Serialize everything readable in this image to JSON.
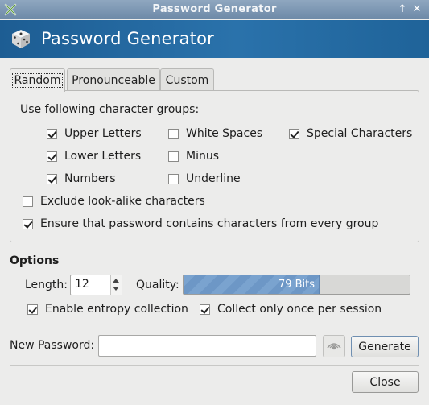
{
  "window": {
    "title": "Password Generator",
    "controls": [
      "↑",
      "✕"
    ]
  },
  "banner": {
    "heading": "Password Generator",
    "icon": "dice-icon"
  },
  "tabs": [
    {
      "label": "Random",
      "active": true
    },
    {
      "label": "Pronounceable",
      "active": false
    },
    {
      "label": "Custom",
      "active": false
    }
  ],
  "random": {
    "groups_label": "Use following character groups:",
    "upper": {
      "label": "Upper Letters",
      "checked": true
    },
    "lower": {
      "label": "Lower Letters",
      "checked": true
    },
    "numbers": {
      "label": "Numbers",
      "checked": true
    },
    "white_spaces": {
      "label": "White Spaces",
      "checked": false
    },
    "minus": {
      "label": "Minus",
      "checked": false
    },
    "underline": {
      "label": "Underline",
      "checked": false
    },
    "special": {
      "label": "Special Characters",
      "checked": true
    },
    "exclude_lookalike": {
      "label": "Exclude look-alike characters",
      "checked": false
    },
    "ensure_every_group": {
      "label": "Ensure that password contains characters from every group",
      "checked": true
    }
  },
  "options": {
    "heading": "Options",
    "length_label": "Length:",
    "length_value": "12",
    "quality_label": "Quality:",
    "quality_text": "79 Bits",
    "quality_fraction": 0.6,
    "entropy": {
      "label": "Enable entropy collection",
      "checked": true
    },
    "collect_once": {
      "label": "Collect only once per session",
      "checked": true
    }
  },
  "new_password": {
    "label": "New Password:",
    "value": "",
    "generate_label": "Generate"
  },
  "footer": {
    "close_label": "Close"
  },
  "colors": {
    "banner": "#2a72ab",
    "titlebar": "#7f99b6",
    "quality_fill": "#7aa3cf"
  }
}
